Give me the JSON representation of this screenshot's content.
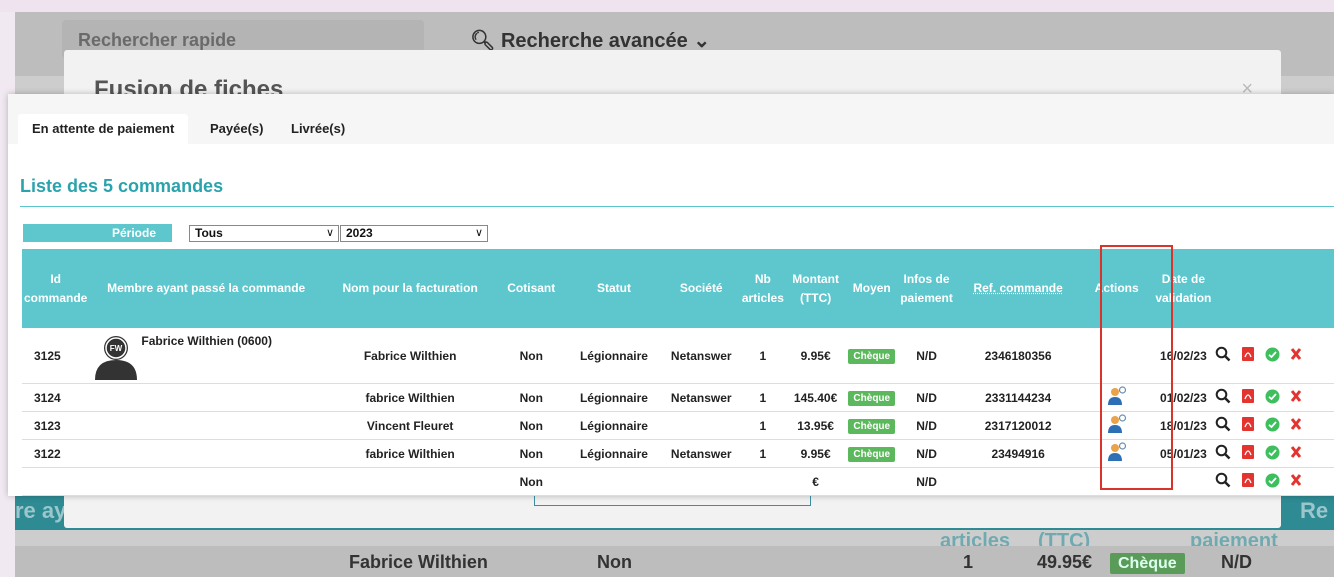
{
  "background": {
    "search_placeholder": "Rechercher rapide",
    "advanced_search": "Recherche avancée",
    "header_partial_left": "re aya",
    "header_partial_right": "Re",
    "header_fragments": [
      "articles",
      "(TTC)",
      "paiement"
    ],
    "row": {
      "name": "Fabrice Wilthien",
      "cotisant": "Non",
      "nb": "1",
      "montant": "49.95€",
      "moyen": "Chèque",
      "infos": "N/D"
    }
  },
  "modal": {
    "title": "Fusion de fiches",
    "close": "×"
  },
  "tabs": [
    {
      "label": "En attente de paiement"
    },
    {
      "label": "Payée(s)"
    },
    {
      "label": "Livrée(s)"
    }
  ],
  "list_title": "Liste des 5 commandes",
  "filters": {
    "periode_label": "Période",
    "periode_value": "Tous",
    "year_value": "2023"
  },
  "columns": [
    "Id commande",
    "Membre ayant passé la commande",
    "Nom pour la facturation",
    "Cotisant",
    "Statut",
    "Société",
    "Nb articles",
    "Montant (TTC)",
    "Moyen",
    "Infos de paiement",
    "Ref. commande",
    "Actions",
    "Date de validation",
    ""
  ],
  "rows": [
    {
      "id": "3125",
      "member": "Fabrice Wilthien (0600)",
      "avatar_initials": "FW",
      "billing": "Fabrice Wilthien",
      "cotisant": "Non",
      "statut": "Légionnaire",
      "societe": "Netanswer",
      "nb": "1",
      "montant": "9.95€",
      "moyen": "Chèque",
      "infos": "N/D",
      "ref": "2346180356",
      "action_icon": false,
      "date": "16/02/23"
    },
    {
      "id": "3124",
      "member": "",
      "billing": "fabrice Wilthien",
      "cotisant": "Non",
      "statut": "Légionnaire",
      "societe": "Netanswer",
      "nb": "1",
      "montant": "145.40€",
      "moyen": "Chèque",
      "infos": "N/D",
      "ref": "2331144234",
      "action_icon": true,
      "date": "01/02/23"
    },
    {
      "id": "3123",
      "member": "",
      "billing": "Vincent Fleuret",
      "cotisant": "Non",
      "statut": "Légionnaire",
      "societe": "",
      "nb": "1",
      "montant": "13.95€",
      "moyen": "Chèque",
      "infos": "N/D",
      "ref": "2317120012",
      "action_icon": true,
      "date": "18/01/23"
    },
    {
      "id": "3122",
      "member": "",
      "billing": "fabrice Wilthien",
      "cotisant": "Non",
      "statut": "Légionnaire",
      "societe": "Netanswer",
      "nb": "1",
      "montant": "9.95€",
      "moyen": "Chèque",
      "infos": "N/D",
      "ref": "23494916",
      "action_icon": true,
      "date": "05/01/23"
    },
    {
      "id": "",
      "member": "",
      "billing": "",
      "cotisant": "Non",
      "statut": "",
      "societe": "",
      "nb": "",
      "montant": "€",
      "moyen": "",
      "infos": "N/D",
      "ref": "",
      "action_icon": false,
      "date": ""
    }
  ],
  "colors": {
    "teal": "#5ec7ce",
    "title_teal": "#2aa3ad",
    "cheque_green": "#5cb85c",
    "highlight_red": "#d9342b"
  }
}
